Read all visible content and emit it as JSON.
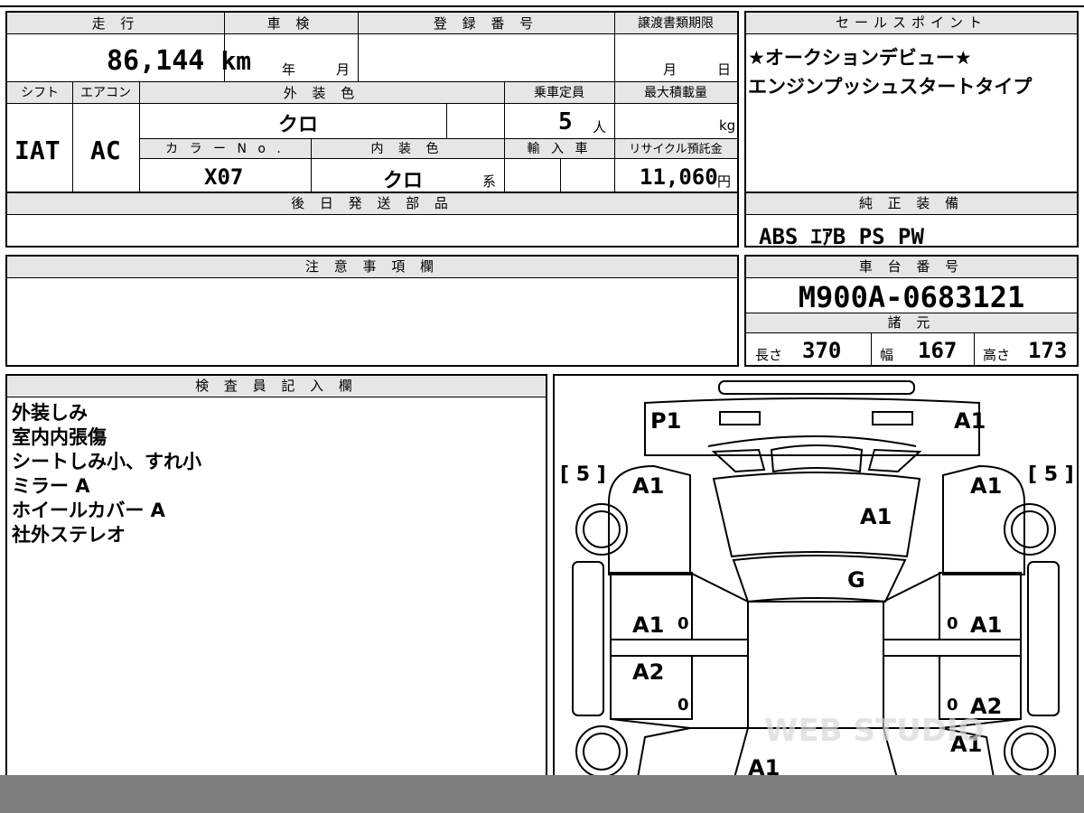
{
  "vehicle": {
    "mileage_header": "走 行",
    "mileage_value": "86,144",
    "mileage_unit": "km",
    "inspection_header": "車 検",
    "inspection_year_unit": "年",
    "inspection_month_unit": "月",
    "registration_header": "登 録 番 号",
    "transfer_header": "譲渡書類期限",
    "transfer_month_unit": "月",
    "transfer_day_unit": "日",
    "shift_header": "シフト",
    "shift_value": "IAT",
    "ac_header": "エアコン",
    "ac_value": "AC",
    "exterior_header": "外 装 色",
    "exterior_value": "クロ",
    "capacity_header": "乗車定員",
    "capacity_value": "5",
    "capacity_unit": "人",
    "load_header": "最大積載量",
    "load_unit": "kg",
    "color_no_header": "カ ラ ー N o .",
    "color_no_value": "X07",
    "interior_header": "内 装 色",
    "interior_value": "クロ",
    "interior_unit": "系",
    "import_header": "輸 入 車",
    "recycle_header": "リサイクル預託金",
    "recycle_value": "11,060",
    "recycle_unit": "円"
  },
  "later_parts": {
    "header": "後 日 発 送 部 品"
  },
  "notes": {
    "header": "注 意 事 項 欄"
  },
  "sales_points": {
    "header": "セールスポイント",
    "line1": "★オークションデビュー★",
    "line2": "エンジンプッシュスタートタイプ"
  },
  "equipment": {
    "header": "純 正 装 備",
    "value": "ABS ｴｱB PS PW"
  },
  "chassis": {
    "header": "車 台 番 号",
    "value": "M900A-0683121"
  },
  "specs": {
    "header": "諸 元",
    "length_label": "長さ",
    "length_value": "370",
    "width_label": "幅",
    "width_value": "167",
    "height_label": "高さ",
    "height_value": "173"
  },
  "inspector": {
    "header": "検 査 員 記 入 欄",
    "lines": [
      "外装しみ",
      "室内内張傷",
      "シートしみ小、すれ小",
      "ミラー A",
      "ホイールカバー A",
      "社外ステレオ"
    ]
  },
  "diagram": {
    "left_tire": "[ 5 ]",
    "right_tire": "[ 5 ]",
    "marks": {
      "front_left_bumper": "P1",
      "front_right_bumper": "A1",
      "left_front_fender": "A1",
      "right_front_fender": "A1",
      "hood": "A1",
      "windshield": "G",
      "left_front_door": "A1",
      "left_rear_door": "A2",
      "right_front_door": "A1",
      "right_rear_door": "A2",
      "right_rear_fender": "A1",
      "rear": "A1",
      "door_zero_1": "0",
      "door_zero_2": "0",
      "door_zero_3": "0",
      "door_zero_4": "0"
    },
    "watermark": "WEB STUDIO"
  }
}
